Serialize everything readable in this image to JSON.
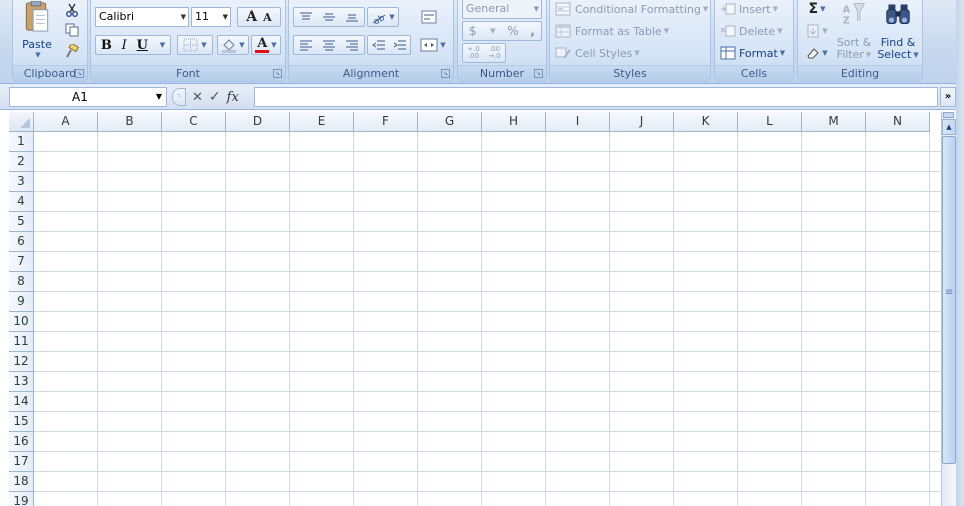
{
  "ribbon": {
    "clipboard": {
      "label": "Clipboard",
      "paste": "Paste"
    },
    "font": {
      "label": "Font",
      "font_name": "Calibri",
      "font_size": "11",
      "grow": "A",
      "shrink": "A",
      "bold": "B",
      "italic": "I",
      "underline": "U",
      "font_color_glyph": "A"
    },
    "alignment": {
      "label": "Alignment"
    },
    "number": {
      "label": "Number",
      "format": "General",
      "currency": "$",
      "percent": "%",
      "comma": ",",
      "inc_decimal": "+.0 .00",
      "dec_decimal": ".00 →.0"
    },
    "styles": {
      "label": "Styles",
      "conditional": "Conditional Formatting",
      "format_table": "Format as Table",
      "cell_styles": "Cell Styles"
    },
    "cells": {
      "label": "Cells",
      "insert": "Insert",
      "delete": "Delete",
      "format": "Format"
    },
    "editing": {
      "label": "Editing",
      "sigma": "Σ",
      "sort_line1": "Sort &",
      "sort_line2": "Filter",
      "find_line1": "Find &",
      "find_line2": "Select"
    }
  },
  "formula_bar": {
    "name_box": "A1",
    "cancel": "✕",
    "enter": "✓",
    "fx": "fx",
    "formula": "",
    "expand": "»"
  },
  "sheet": {
    "columns": [
      "A",
      "B",
      "C",
      "D",
      "E",
      "F",
      "G",
      "H",
      "I",
      "J",
      "K",
      "L",
      "M",
      "N"
    ],
    "rows": [
      "1",
      "2",
      "3",
      "4",
      "5",
      "6",
      "7",
      "8",
      "9",
      "10",
      "11",
      "12",
      "13",
      "14",
      "15",
      "16",
      "17",
      "18",
      "19"
    ]
  },
  "colors": {
    "accent": "#15428b",
    "grid": "#d0d7e5",
    "header_border": "#9eb6ce"
  }
}
